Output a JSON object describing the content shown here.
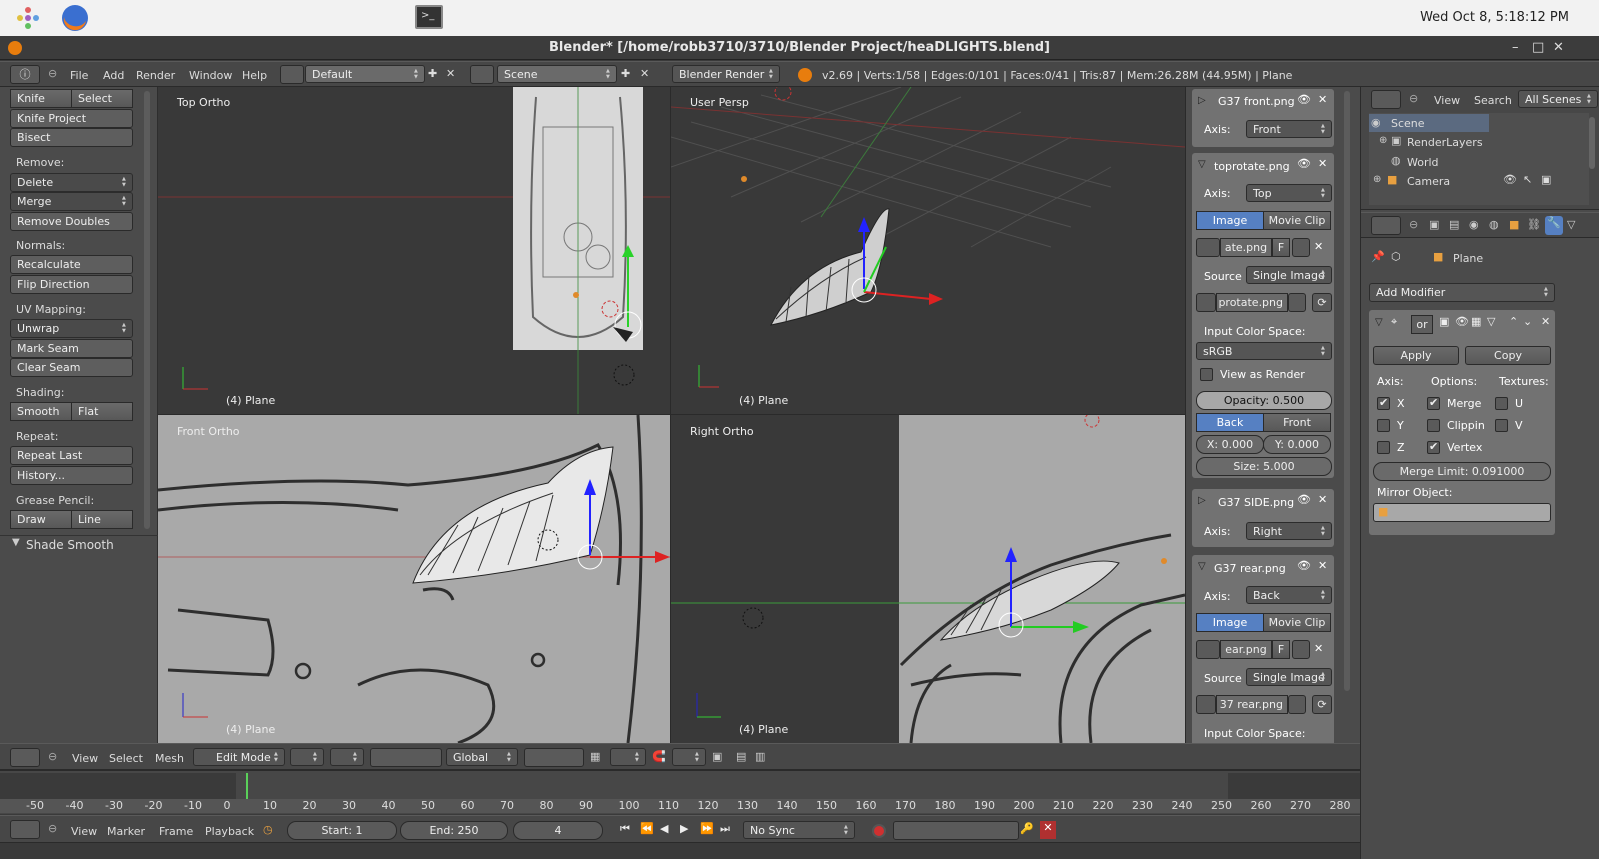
{
  "os": {
    "clock": "Wed Oct  8,  5:18:12 PM"
  },
  "window": {
    "title": "Blender* [/home/robb3710/3710/Blender Project/heaDLIGHTS.blend]"
  },
  "info_header": {
    "menus": [
      "File",
      "Add",
      "Render",
      "Window",
      "Help"
    ],
    "layout": "Default",
    "scene": "Scene",
    "engine": "Blender Render",
    "stats": "v2.69 | Verts:1/58 | Edges:0/101 | Faces:0/41 | Tris:87 | Mem:26.28M (44.95M) | Plane"
  },
  "toolshelf": {
    "knife": "Knife",
    "select": "Select",
    "knife_project": "Knife Project",
    "bisect": "Bisect",
    "remove_label": "Remove:",
    "delete": "Delete",
    "merge": "Merge",
    "remove_doubles": "Remove Doubles",
    "normals_label": "Normals:",
    "recalculate": "Recalculate",
    "flip_direction": "Flip Direction",
    "uv_label": "UV Mapping:",
    "unwrap": "Unwrap",
    "mark_seam": "Mark Seam",
    "clear_seam": "Clear Seam",
    "shading_label": "Shading:",
    "smooth": "Smooth",
    "flat": "Flat",
    "repeat_label": "Repeat:",
    "repeat_last": "Repeat Last",
    "history": "History...",
    "grease_label": "Grease Pencil:",
    "draw": "Draw",
    "line": "Line",
    "operator": "Shade Smooth"
  },
  "viewports": {
    "top": {
      "name": "Top Ortho",
      "object": "(4) Plane"
    },
    "persp": {
      "name": "User Persp",
      "object": "(4) Plane"
    },
    "front": {
      "name": "Front Ortho",
      "object": "(4) Plane"
    },
    "right": {
      "name": "Right Ortho",
      "object": "(4) Plane"
    }
  },
  "bg_panel": {
    "img1": {
      "name": "G37 front.png",
      "axis_label": "Axis:",
      "axis": "Front"
    },
    "img2": {
      "name": "toprotate.png",
      "axis_label": "Axis:",
      "axis": "Top",
      "tab_image": "Image",
      "tab_clip": "Movie Clip",
      "file": "ate.png",
      "f": "F",
      "source_label": "Source",
      "source": "Single Image",
      "path": "protate.png",
      "colorspace_label": "Input Color Space:",
      "colorspace": "sRGB",
      "view_render": "View as Render",
      "opacity": "Opacity: 0.500",
      "back": "Back",
      "front": "Front",
      "x": "X: 0.000",
      "y": "Y: 0.000",
      "size": "Size: 5.000"
    },
    "img3": {
      "name": "G37 SIDE.png",
      "axis_label": "Axis:",
      "axis": "Right"
    },
    "img4": {
      "name": "G37 rear.png",
      "axis_label": "Axis:",
      "axis": "Back",
      "tab_image": "Image",
      "tab_clip": "Movie Clip",
      "file": "ear.png",
      "f": "F",
      "source_label": "Source",
      "source": "Single Image",
      "path": "37 rear.png",
      "colorspace_label": "Input Color Space:"
    }
  },
  "outliner": {
    "menus": [
      "View",
      "Search"
    ],
    "filter": "All Scenes",
    "items": [
      "Scene",
      "RenderLayers",
      "World",
      "Camera"
    ]
  },
  "properties": {
    "object": "Plane",
    "add_modifier": "Add Modifier",
    "mod_name": "or",
    "apply": "Apply",
    "copy": "Copy",
    "axis_label": "Axis:",
    "options_label": "Options:",
    "textures_label": "Textures:",
    "x": "X",
    "y": "Y",
    "z": "Z",
    "merge": "Merge",
    "clipping": "Clippin",
    "vertex": "Vertex",
    "u": "U",
    "v": "V",
    "merge_limit": "Merge Limit: 0.091000",
    "mirror_object": "Mirror Object:"
  },
  "view3d_header": {
    "menus": [
      "View",
      "Select",
      "Mesh"
    ],
    "mode": "Edit Mode",
    "orientation": "Global"
  },
  "timeline": {
    "ticks": [
      "-50",
      "-40",
      "-30",
      "-20",
      "-10",
      "0",
      "10",
      "20",
      "30",
      "40",
      "50",
      "60",
      "70",
      "80",
      "90",
      "100",
      "110",
      "120",
      "130",
      "140",
      "150",
      "160",
      "170",
      "180",
      "190",
      "200",
      "210",
      "220",
      "230",
      "240",
      "250",
      "260",
      "270",
      "280"
    ],
    "menus": [
      "View",
      "Marker",
      "Frame",
      "Playback"
    ],
    "start": "Start: 1",
    "end": "End: 250",
    "current": "4",
    "sync": "No Sync"
  }
}
